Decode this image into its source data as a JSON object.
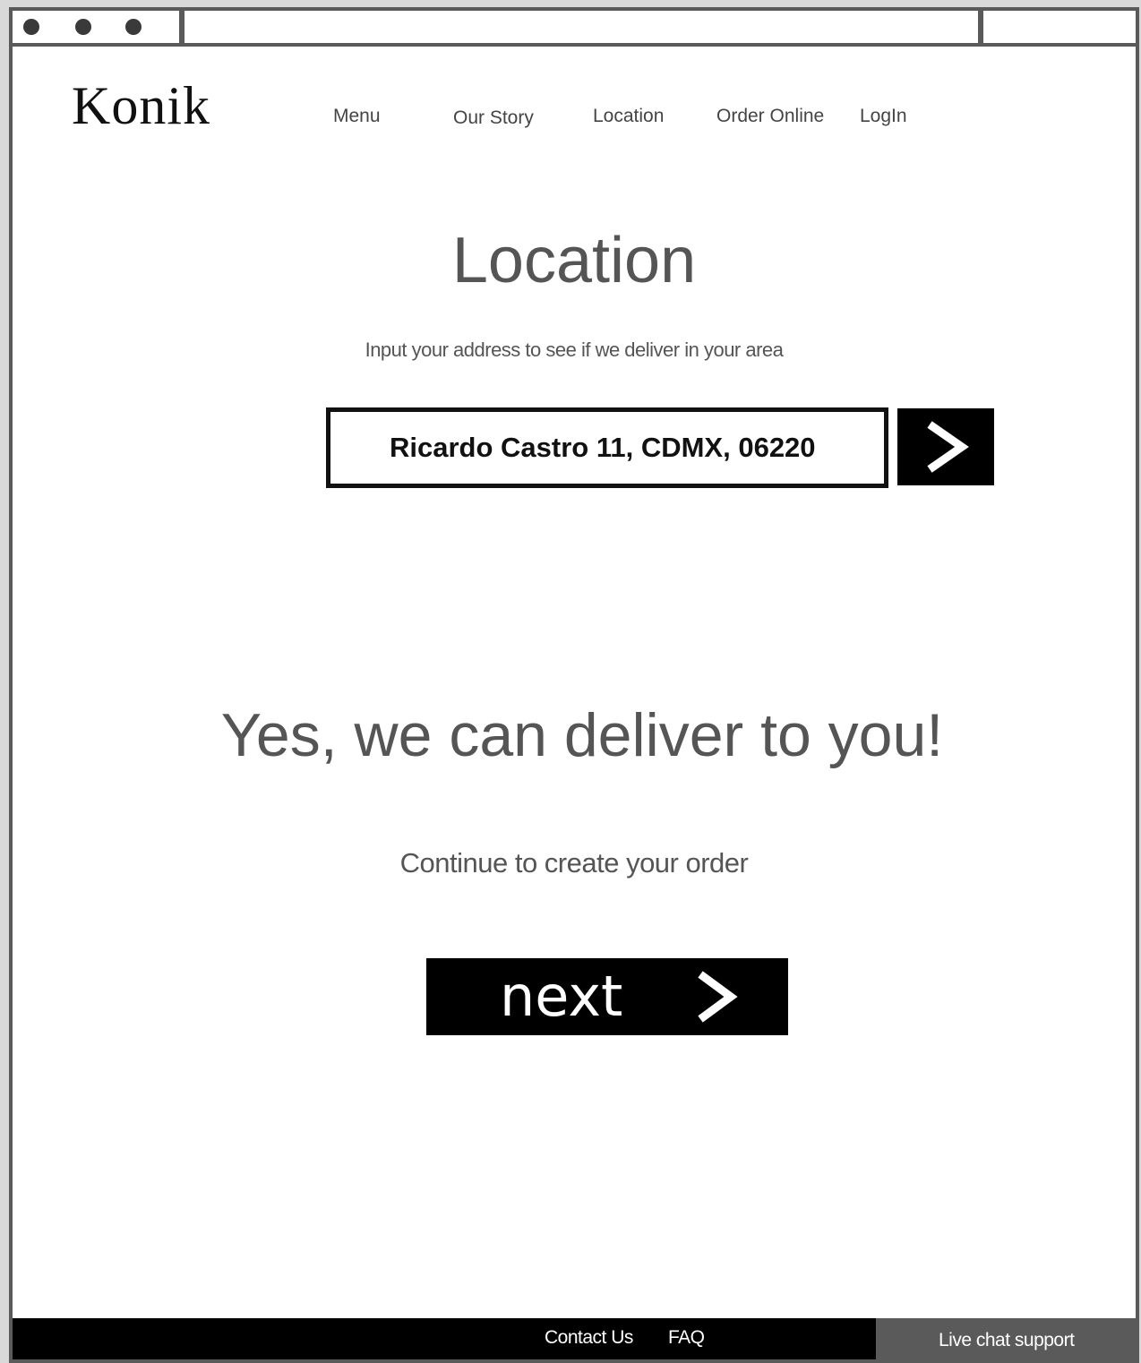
{
  "header": {
    "logo": "Konik",
    "nav": {
      "menu": "Menu",
      "our_story": "Our Story",
      "location": "Location",
      "order_online": "Order Online",
      "login": "LogIn"
    }
  },
  "main": {
    "title": "Location",
    "subtitle": "Input your address to see if we deliver in your area",
    "address_input_value": "Ricardo Castro 11, CDMX, 06220",
    "submit_icon": "chevron-right-icon",
    "result_headline": "Yes, we can deliver to you!",
    "continue_text": "Continue to create your order",
    "next_label": "next",
    "next_icon": "chevron-right-icon"
  },
  "footer": {
    "contact_us": "Contact Us",
    "faq": "FAQ",
    "live_chat": "Live chat support"
  },
  "colors": {
    "frame": "#5a5a5a",
    "text": "#555555",
    "button": "#000000",
    "live_chat_bg": "#5a5a5a"
  }
}
